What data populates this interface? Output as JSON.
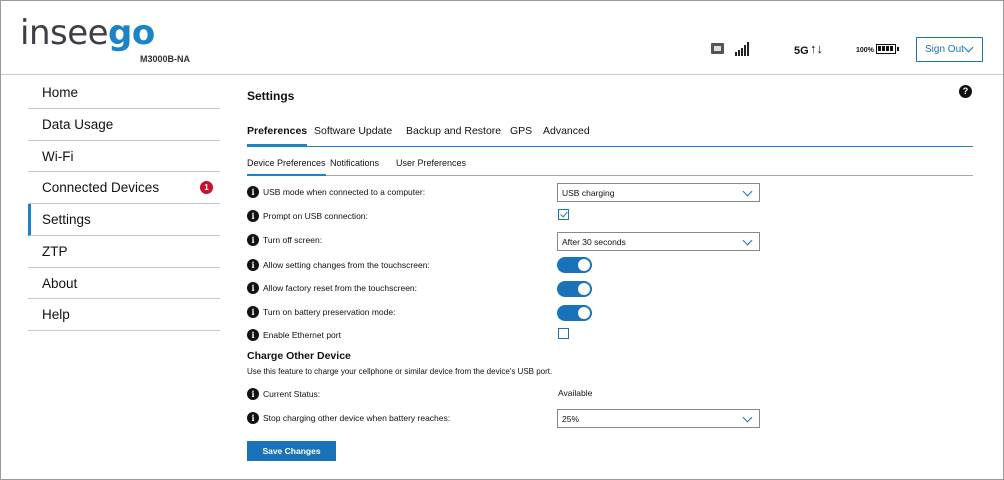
{
  "header": {
    "logo_part1": "insee",
    "logo_part2": "go",
    "model": "M3000B-NA",
    "network": "5G",
    "arrows": "↑↓",
    "battery_pct": "100%",
    "sign_out_label": "Sign Out"
  },
  "sidebar": {
    "items": [
      {
        "label": "Home"
      },
      {
        "label": "Data Usage"
      },
      {
        "label": "Wi-Fi"
      },
      {
        "label": "Connected Devices",
        "badge": "1"
      },
      {
        "label": "Settings",
        "active": true
      },
      {
        "label": "ZTP"
      },
      {
        "label": "About"
      },
      {
        "label": "Help"
      }
    ]
  },
  "main": {
    "title": "Settings",
    "help_glyph": "?",
    "tabs": [
      "Preferences",
      "Software Update",
      "Backup and Restore",
      "GPS",
      "Advanced"
    ],
    "subtabs": [
      "Device Preferences",
      "Notifications",
      "User Preferences"
    ],
    "info_glyph": "i",
    "rows": {
      "usb_mode": {
        "label": "USB mode when connected to a computer:",
        "value": "USB charging"
      },
      "prompt_usb": {
        "label": "Prompt on USB connection:",
        "checked": true
      },
      "turn_off_screen": {
        "label": "Turn off screen:",
        "value": "After 30 seconds"
      },
      "allow_settings": {
        "label": "Allow setting changes from the touchscreen:",
        "on": true
      },
      "allow_factory": {
        "label": "Allow factory reset from the touchscreen:",
        "on": true
      },
      "battery_preservation": {
        "label": "Turn on battery preservation mode:",
        "on": true
      },
      "ethernet": {
        "label": "Enable Ethernet port",
        "checked": false
      }
    },
    "charge": {
      "title": "Charge Other Device",
      "description": "Use this feature to charge your cellphone or similar device from the device's USB port.",
      "status_label": "Current Status:",
      "status_value": "Available",
      "stop_label": "Stop charging other device when battery reaches:",
      "stop_value": "25%"
    },
    "save_label": "Save Changes"
  },
  "colors": {
    "accent": "#1a73b8",
    "badge": "#c8102e"
  }
}
